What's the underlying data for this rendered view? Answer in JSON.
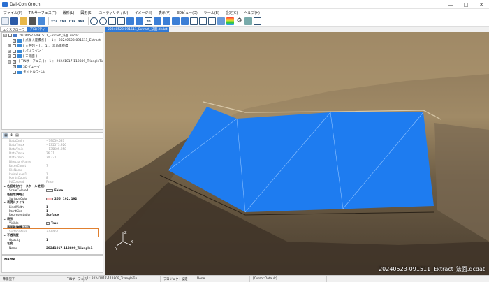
{
  "window": {
    "title": "Dai-Con Orochi",
    "minimize": "—",
    "maximize": "□",
    "close": "✕"
  },
  "menu": [
    "ファイル(F)",
    "TINサーフェス(T)",
    "線形(L)",
    "図形(S)",
    "ユーティリティ(U)",
    "イメージ(I)",
    "表示(V)",
    "3Dビュー(D)",
    "ツール(E)",
    "設定(C)",
    "ヘルプ(H)"
  ],
  "toolbar": {
    "xyz_label": "XYZ",
    "xml_label": "XML",
    "dxf_label": "DXF",
    "two_d_label": "2D"
  },
  "left_tabs": {
    "explorer": "エクスプローラ",
    "property": "プロパティ"
  },
  "tree": [
    {
      "label": "20240523-091511_Extract_法面.dcdat",
      "indent": 0,
      "expander": "⊟",
      "checked": ""
    },
    {
      "label": "[ 点群 / 座標点 ] ： 1 ： 20240523-091511_Extract",
      "indent": 1,
      "expander": "",
      "checked": "✓"
    },
    {
      "label": "[ 文字列ト ] ： 1 ： 三角面座標",
      "indent": 1,
      "expander": "⊞",
      "checked": ""
    },
    {
      "label": "[ ポリライン ]",
      "indent": 1,
      "expander": "⊞",
      "checked": ""
    },
    {
      "label": "[ 三角面 ]",
      "indent": 1,
      "expander": "⊞",
      "checked": ""
    },
    {
      "label": "[ TINサーフェス ] ： 1 ： 20241017-112809_TriangleTin",
      "indent": 1,
      "expander": "⊟",
      "checked": "✓"
    },
    {
      "label": "3Dヴューイ",
      "indent": 1,
      "expander": "",
      "checked": "✓"
    },
    {
      "label": "タイトルラベル",
      "indent": 1,
      "expander": "",
      "checked": ""
    }
  ],
  "properties": [
    {
      "k": "DataXmin",
      "v": "−79059.537",
      "type": "gray"
    },
    {
      "k": "DataYmax",
      "v": "−135573.926",
      "type": "gray"
    },
    {
      "k": "DataYmin",
      "v": "−135605.958",
      "type": "gray"
    },
    {
      "k": "DataZmax",
      "v": "26.71",
      "type": "gray"
    },
    {
      "k": "DataZmin",
      "v": "20.221",
      "type": "gray"
    },
    {
      "k": "DirectoryName",
      "v": "",
      "type": "gray"
    },
    {
      "k": "FacesCount",
      "v": "7",
      "type": "gray"
    },
    {
      "k": "FileName",
      "v": "",
      "type": "gray"
    },
    {
      "k": "IndexLevel1",
      "v": "1",
      "type": "gray"
    },
    {
      "k": "PointsCount",
      "v": "8",
      "type": "gray"
    },
    {
      "k": "PtlColored",
      "v": "False",
      "type": "gray"
    },
    {
      "k": "色設定(カラースケール使用)",
      "v": "",
      "type": "cat"
    },
    {
      "k": "ScaleColored",
      "v": "False",
      "type": "swatch",
      "sw": "#ffffff"
    },
    {
      "k": "色設定(単色)",
      "v": "",
      "type": "cat"
    },
    {
      "k": "SurfaceColor",
      "v": "255, 192, 192",
      "type": "swatch",
      "sw": "#ffc0c0"
    },
    {
      "k": "表現スタイル",
      "v": "",
      "type": "cat"
    },
    {
      "k": "LineWidth",
      "v": "1",
      "type": "norm"
    },
    {
      "k": "PointSize",
      "v": "1",
      "type": "norm"
    },
    {
      "k": "Representation",
      "v": "Surface",
      "type": "norm"
    },
    {
      "k": "表示",
      "v": "",
      "type": "cat"
    },
    {
      "k": "Visible",
      "v": "True",
      "type": "check"
    },
    {
      "k": "表面積(編集不可)",
      "v": "",
      "type": "cat"
    },
    {
      "k": "SurfaceArea",
      "v": "373.667",
      "type": "gray"
    },
    {
      "k": "不透明度",
      "v": "",
      "type": "cat"
    },
    {
      "k": "Opacity",
      "v": "1",
      "type": "norm"
    },
    {
      "k": "名前",
      "v": "",
      "type": "cat"
    },
    {
      "k": "Name",
      "v": "20241017-112809_Triangle1",
      "type": "norm"
    }
  ],
  "description_title": "Name",
  "view": {
    "tab": "20240523-091511_Extract_法面.dcdat",
    "label": "20240523-091511_Extract_法面.dcdat",
    "axis_z": "Z",
    "axis_x": "X",
    "axis_y": "Y"
  },
  "status": [
    "準備完了",
    "",
    "TINサーフェス",
    "1 : 20241017-112809_TriangleTin",
    "プロジェクト設定",
    "None",
    "[Cursor:Default]"
  ],
  "colors": {
    "surface": "#1e7cf0",
    "accent": "#3079d6",
    "highlight": "#e08030"
  }
}
